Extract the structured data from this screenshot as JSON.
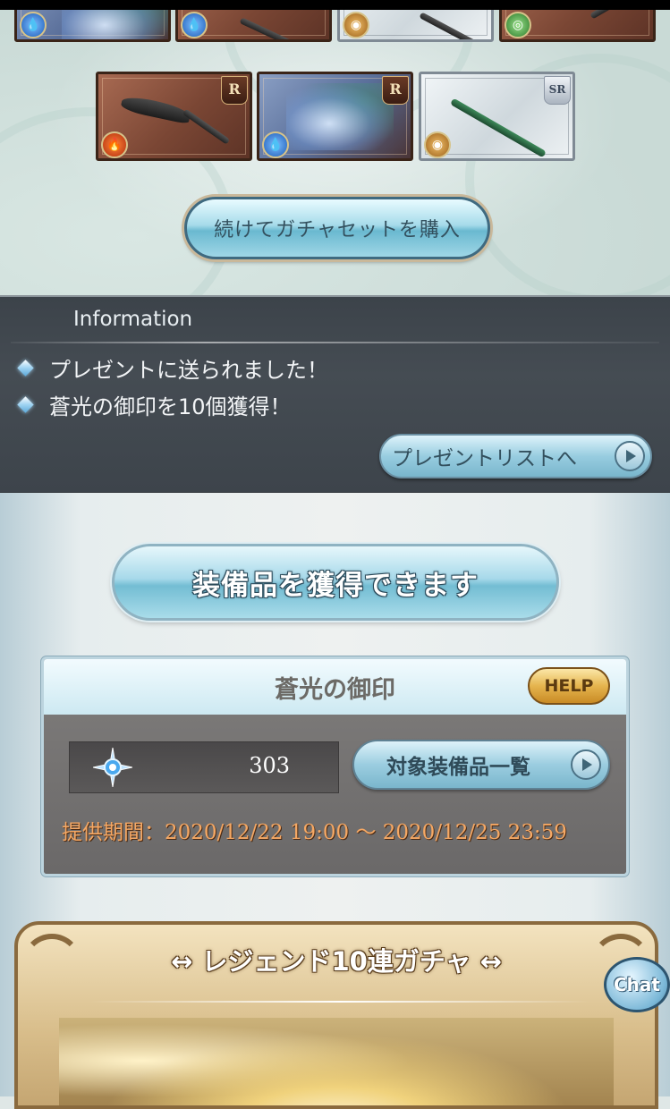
{
  "result_cards": {
    "row1": [
      {
        "rarity": "",
        "element": "water"
      },
      {
        "rarity": "",
        "element": "water"
      },
      {
        "rarity": "",
        "element": "earth"
      },
      {
        "rarity": "",
        "element": "wind"
      }
    ],
    "row2": [
      {
        "rarity": "R",
        "element": "fire"
      },
      {
        "rarity": "R",
        "element": "water"
      },
      {
        "rarity": "SR",
        "element": "earth"
      }
    ]
  },
  "gacha_button": {
    "label": "続けてガチャセットを購入"
  },
  "information": {
    "title": "Information",
    "items": [
      "プレゼントに送られました！",
      "蒼光の御印を10個獲得！"
    ],
    "present_button": "プレゼントリストへ"
  },
  "equip_button": {
    "label": "装備品を獲得できます"
  },
  "seal_panel": {
    "title": "蒼光の御印",
    "help_label": "HELP",
    "count": "303",
    "list_button": "対象装備品一覧",
    "period": "提供期間：2020/12/22 19:00 〜 2020/12/25 23:59"
  },
  "banner": {
    "title": "↔ レジェンド10連ガチャ ↔"
  },
  "chat_button": {
    "label": "Chat"
  },
  "colors": {
    "info_bg": "#42494f",
    "accent_button": "#a6dbea",
    "period_text": "#f5a864",
    "help_gold": "#e5b44e"
  }
}
